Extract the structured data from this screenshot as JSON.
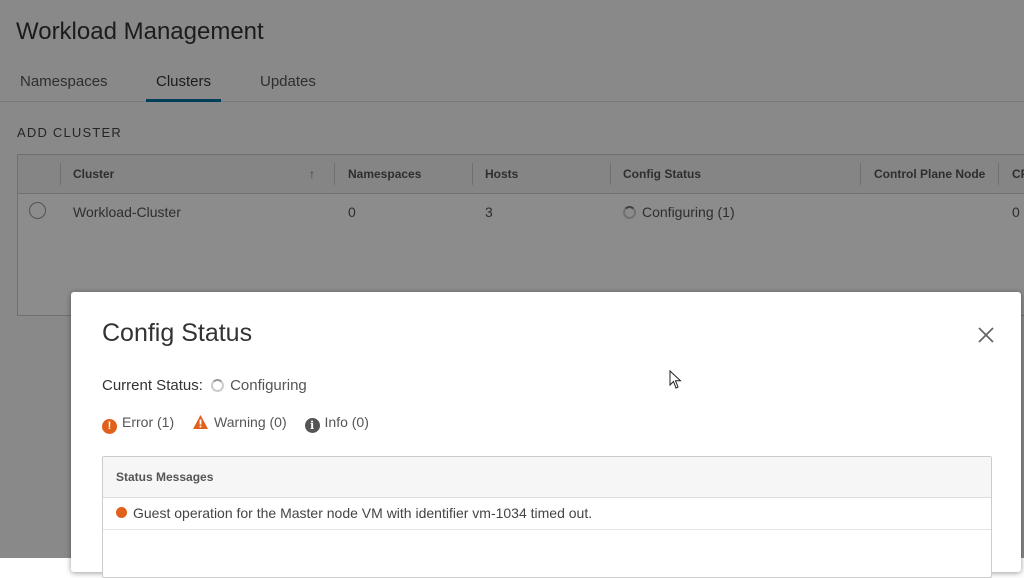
{
  "page": {
    "title": "Workload Management",
    "tabs": [
      {
        "label": "Namespaces",
        "active": false
      },
      {
        "label": "Clusters",
        "active": true
      },
      {
        "label": "Updates",
        "active": false
      }
    ],
    "add_cluster_label": "ADD CLUSTER"
  },
  "grid": {
    "columns": [
      "Cluster",
      "Namespaces",
      "Hosts",
      "Config Status",
      "Control Plane Node",
      "CP"
    ],
    "sort_indicator": "↑",
    "rows": [
      {
        "cluster": "Workload-Cluster",
        "namespaces": "0",
        "hosts": "3",
        "config_status": "Configuring (1)",
        "cpu": "0"
      }
    ]
  },
  "modal": {
    "title": "Config Status",
    "close_icon": "close-icon",
    "current_status_label": "Current Status:",
    "current_status_value": "Configuring",
    "filters": {
      "error": "Error (1)",
      "warning": "Warning (0)",
      "info": "Info (0)"
    },
    "messages_header": "Status Messages",
    "messages": [
      {
        "severity": "error",
        "text": "Guest operation for the Master node VM with identifier vm-1034 timed out."
      }
    ]
  },
  "colors": {
    "error": "#e0601c",
    "accent": "#0072a3"
  }
}
